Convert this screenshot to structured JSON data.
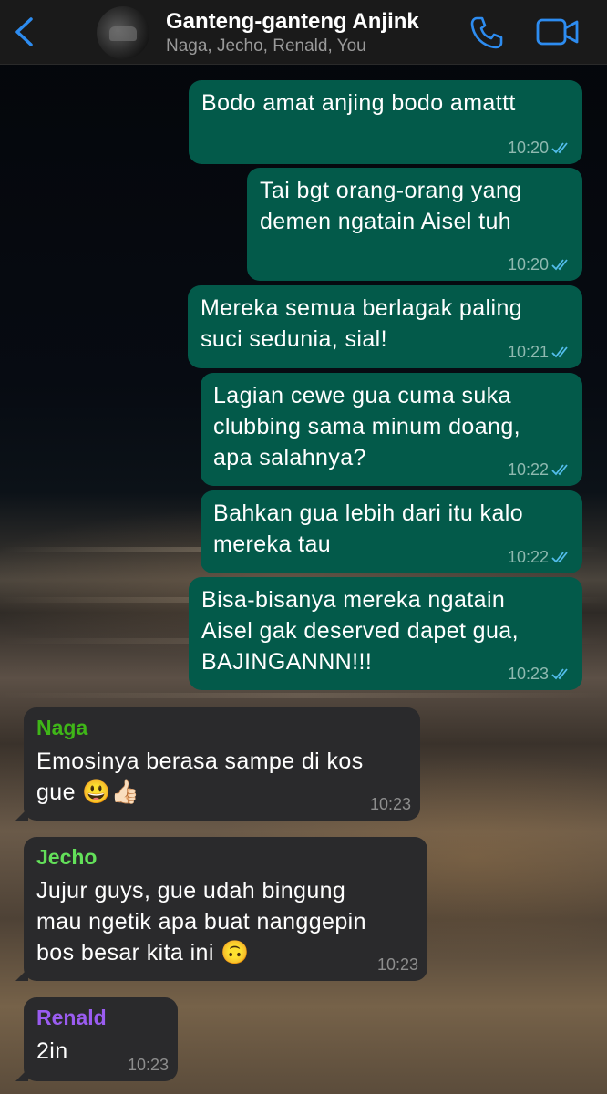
{
  "header": {
    "back_icon": "chevron-left-icon",
    "title": "Ganteng-ganteng Anjink",
    "members": "Naga, Jecho, Renald, You",
    "call_icon": "phone-icon",
    "video_icon": "video-camera-icon",
    "accent_color": "#2d8cf0"
  },
  "messages": [
    {
      "direction": "out",
      "text": "Bodo amat anjing bodo amattt",
      "time": "10:20",
      "status": "read"
    },
    {
      "direction": "out",
      "text": "Tai bgt orang-orang yang\ndemen ngatain Aisel tuh",
      "time": "10:20",
      "status": "read"
    },
    {
      "direction": "out",
      "text": "Mereka semua berlagak paling\nsuci sedunia, sial!",
      "time": "10:21",
      "status": "read"
    },
    {
      "direction": "out",
      "text": "Lagian cewe gua cuma suka\nclubbing sama minum doang,\napa salahnya?",
      "time": "10:22",
      "status": "read"
    },
    {
      "direction": "out",
      "text": "Bahkan gua lebih dari itu kalo\nmereka tau",
      "time": "10:22",
      "status": "read"
    },
    {
      "direction": "out",
      "text": "Bisa-bisanya mereka ngatain\nAisel gak deserved dapet gua,\nBAJINGANNN!!!",
      "time": "10:23",
      "status": "read"
    },
    {
      "direction": "in",
      "sender": "Naga",
      "sender_color": "#3fb618",
      "text": "Emosinya berasa sampe di kos\ngue 😃👍🏻",
      "time": "10:23"
    },
    {
      "direction": "in",
      "sender": "Jecho",
      "sender_color": "#63e05a",
      "text": "Jujur guys, gue udah bingung\nmau ngetik apa buat nanggepin\nbos besar kita ini 🙃",
      "time": "10:23"
    },
    {
      "direction": "in",
      "sender": "Renald",
      "sender_color": "#9a5cf0",
      "text": "2in",
      "time": "10:23"
    }
  ],
  "colors": {
    "outgoing_bubble": "#035a4a",
    "incoming_bubble": "#2a2a2c",
    "read_ticks": "#53bdeb"
  }
}
